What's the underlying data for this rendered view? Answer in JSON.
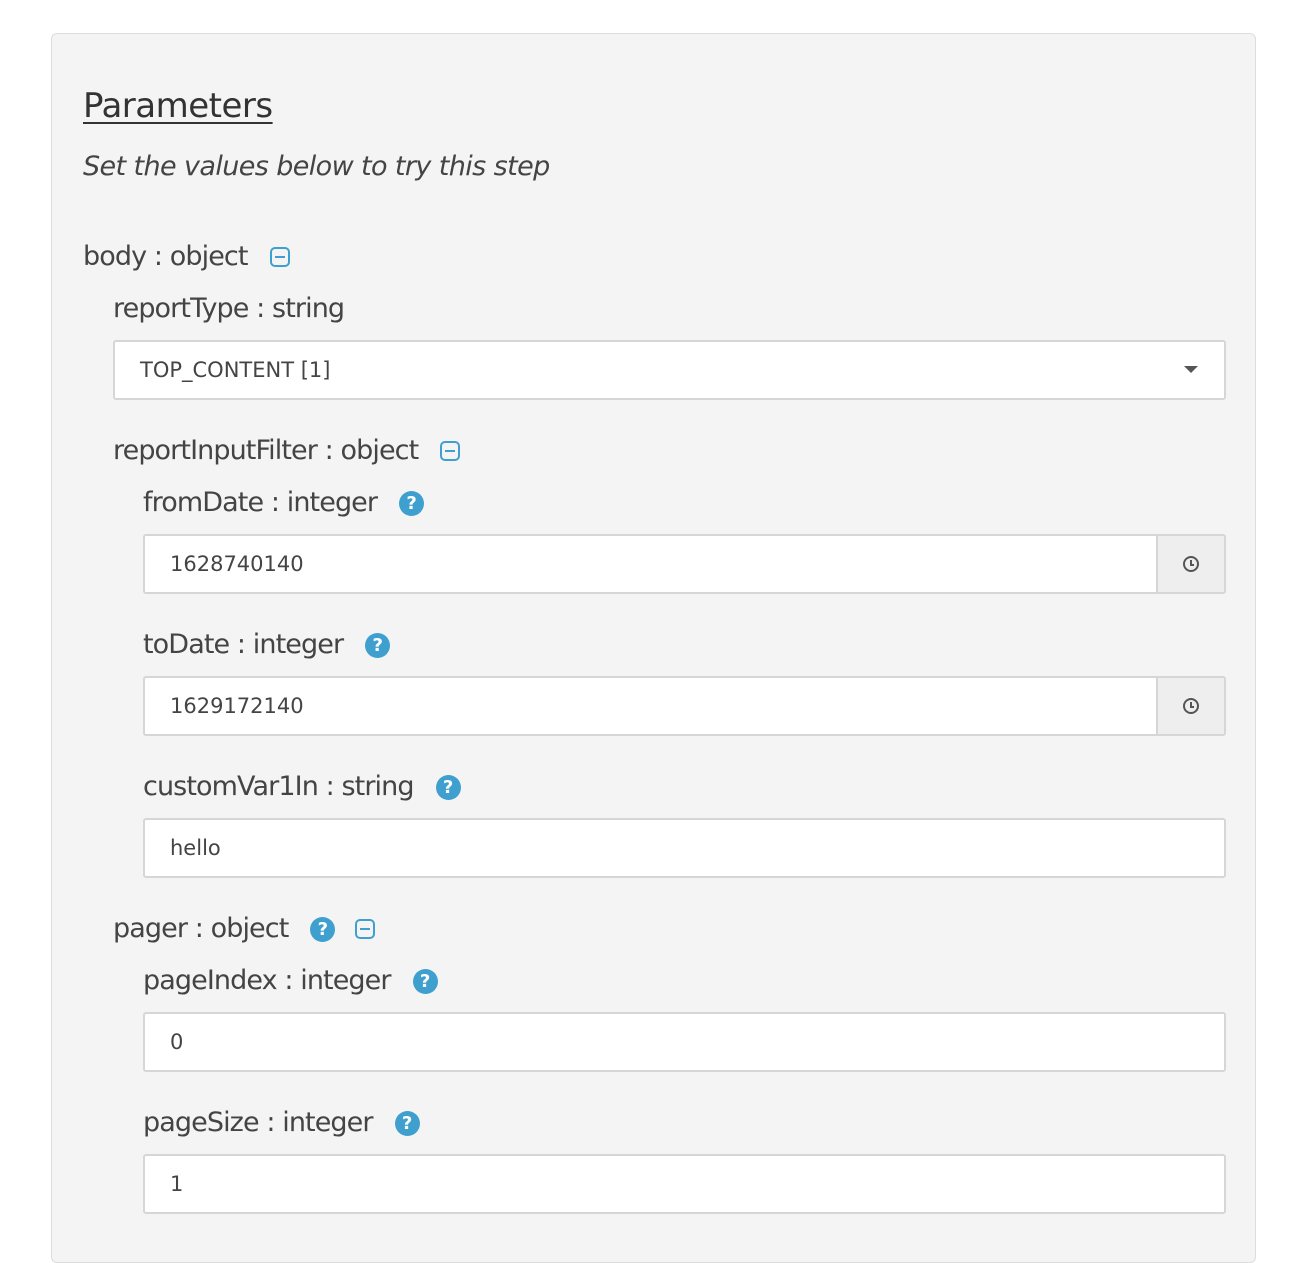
{
  "header": {
    "title": "Parameters",
    "subtitle": "Set the values below to try this step"
  },
  "body": {
    "label": "body : object",
    "reportType": {
      "label": "reportType : string",
      "value": "TOP_CONTENT [1]"
    },
    "reportInputFilter": {
      "label": "reportInputFilter : object",
      "fromDate": {
        "label": "fromDate : integer",
        "value": "1628740140"
      },
      "toDate": {
        "label": "toDate : integer",
        "value": "1629172140"
      },
      "customVar1In": {
        "label": "customVar1In : string",
        "value": "hello"
      }
    },
    "pager": {
      "label": "pager : object",
      "pageIndex": {
        "label": "pageIndex : integer",
        "value": "0"
      },
      "pageSize": {
        "label": "pageSize : integer",
        "value": "1"
      }
    }
  },
  "icons": {
    "help": "?",
    "accent_color": "#3fa0cf"
  }
}
